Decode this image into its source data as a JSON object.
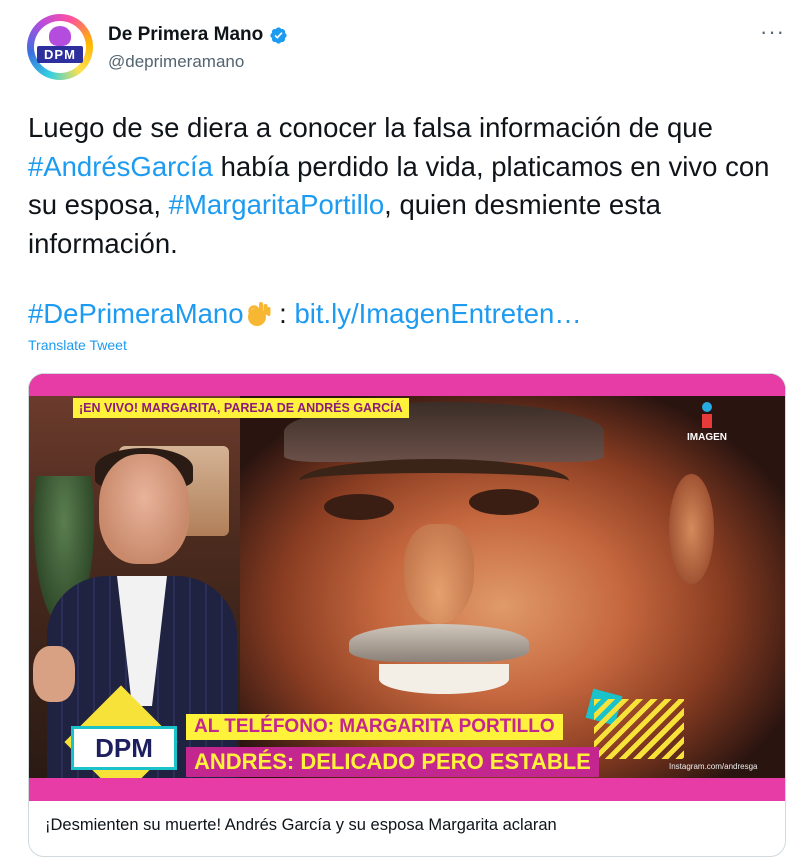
{
  "author": {
    "name": "De Primera Mano",
    "handle": "@deprimeramano",
    "avatar_logo_text": "DPM",
    "verified": true,
    "verified_icon": "verified-badge-icon",
    "verified_color": "#1d9bf0"
  },
  "more_menu_label": "···",
  "tweet": {
    "text_parts": [
      "Luego de se diera a conocer la falsa información de que ",
      "#AndrésGarcía",
      " había perdido la vida, platicamos en vivo con su esposa, ",
      "#MargaritaPortillo",
      ", quien desmiente esta información."
    ],
    "hashtag_footer": "#DePrimeraMano",
    "emoji_icon": "ok-hand-icon",
    "link_prefix": " : ",
    "link": "bit.ly/ImagenEntreten…",
    "link_color": "#1d9bf0"
  },
  "translate_label": "Translate Tweet",
  "card": {
    "video": {
      "live_banner": "¡EN VIVO! MARGARITA, PAREJA DE ANDRÉS GARCÍA",
      "channel_logo": "IMAGEN",
      "dpm_logo": "DPM",
      "lower_third_1": "AL TELÉFONO: MARGARITA PORTILLO",
      "lower_third_2": "ANDRÉS: DELICADO PERO ESTABLE",
      "photo_credit": "Instagram.com/andresga"
    },
    "title": "¡Desmienten su muerte! Andrés García y su esposa Margarita aclaran"
  },
  "colors": {
    "accent_pink": "#e73ba6",
    "highlight_yellow": "#fff23a",
    "text_primary": "#0f1419",
    "text_secondary": "#536471"
  }
}
